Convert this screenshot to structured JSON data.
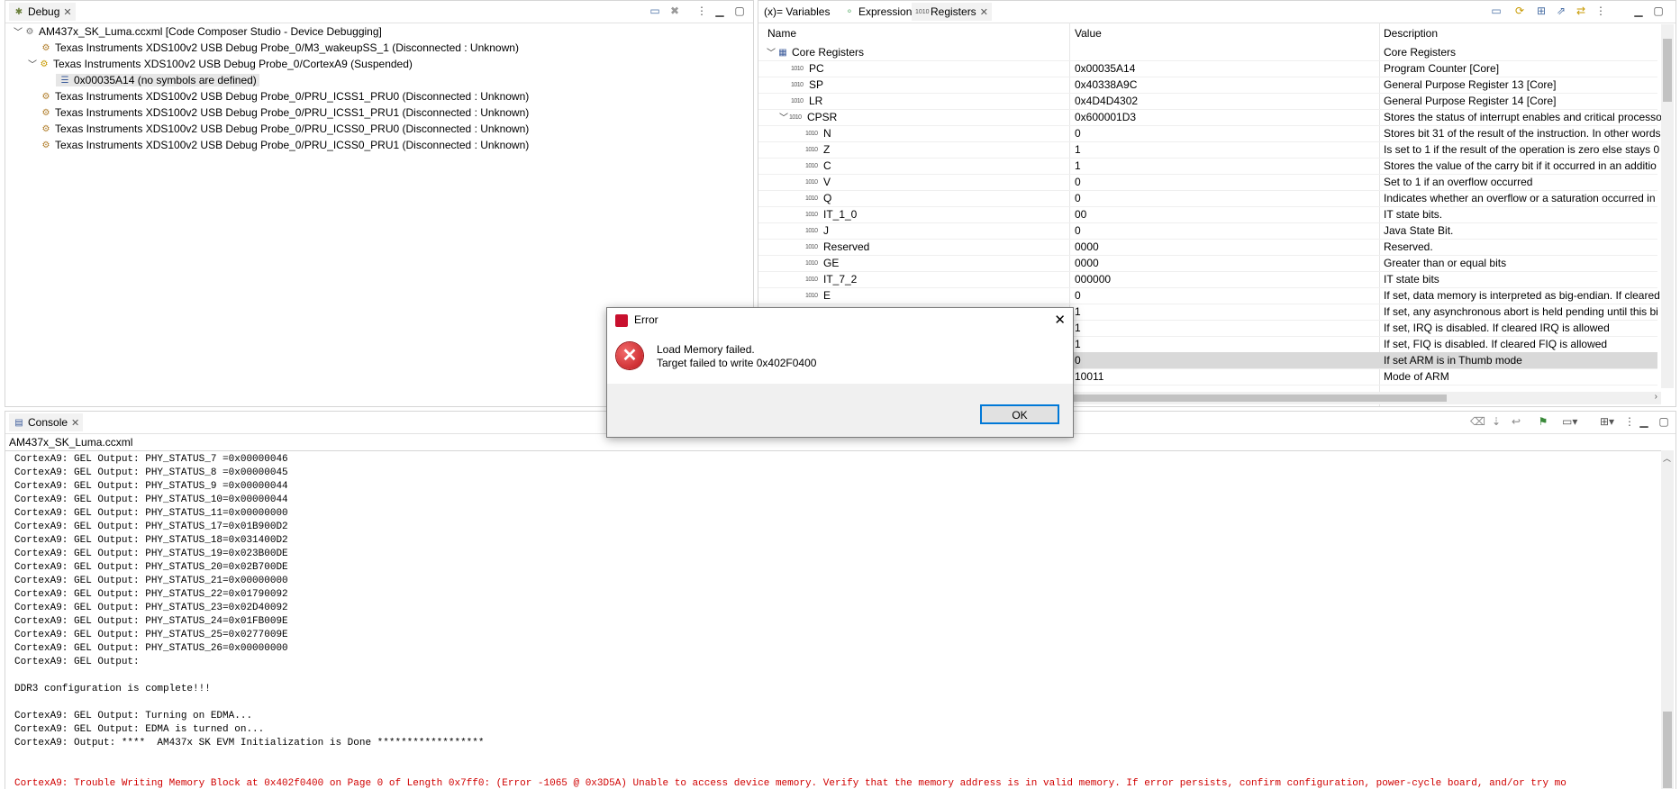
{
  "debug": {
    "tab_label": "Debug",
    "rows": [
      {
        "text": "AM437x_SK_Luma.ccxml [Code Composer Studio - Device Debugging]"
      },
      {
        "text": "Texas Instruments XDS100v2 USB Debug Probe_0/M3_wakeupSS_1 (Disconnected : Unknown)"
      },
      {
        "text": "Texas Instruments XDS100v2 USB Debug Probe_0/CortexA9 (Suspended)"
      },
      {
        "text": "0x00035A14  (no symbols are defined)"
      },
      {
        "text": "Texas Instruments XDS100v2 USB Debug Probe_0/PRU_ICSS1_PRU0 (Disconnected : Unknown)"
      },
      {
        "text": "Texas Instruments XDS100v2 USB Debug Probe_0/PRU_ICSS1_PRU1 (Disconnected : Unknown)"
      },
      {
        "text": "Texas Instruments XDS100v2 USB Debug Probe_0/PRU_ICSS0_PRU0 (Disconnected : Unknown)"
      },
      {
        "text": "Texas Instruments XDS100v2 USB Debug Probe_0/PRU_ICSS0_PRU1 (Disconnected : Unknown)"
      }
    ]
  },
  "registers": {
    "tabs": {
      "variables": "(x)= Variables",
      "expressions": "Expressions",
      "registers": "Registers"
    },
    "columns": {
      "name": "Name",
      "value": "Value",
      "description": "Description"
    },
    "rows": [
      {
        "name": "Core Registers",
        "value": "",
        "desc": "Core Registers"
      },
      {
        "name": "PC",
        "value": "0x00035A14",
        "desc": "Program Counter [Core]"
      },
      {
        "name": "SP",
        "value": "0x40338A9C",
        "desc": "General Purpose Register 13 [Core]"
      },
      {
        "name": "LR",
        "value": "0x4D4D4302",
        "desc": "General Purpose Register 14 [Core]"
      },
      {
        "name": "CPSR",
        "value": "0x600001D3",
        "desc": "Stores the status of interrupt enables and critical processo"
      },
      {
        "name": "N",
        "value": "0",
        "desc": "Stores bit 31 of the result of the instruction. In other words"
      },
      {
        "name": "Z",
        "value": "1",
        "desc": "Is set to 1 if the result of the operation is zero else stays 0"
      },
      {
        "name": "C",
        "value": "1",
        "desc": "Stores the value of the carry bit if it occurred in an additio"
      },
      {
        "name": "V",
        "value": "0",
        "desc": "Set to 1 if an overflow occurred"
      },
      {
        "name": "Q",
        "value": "0",
        "desc": "Indicates whether an overflow or a saturation occurred in"
      },
      {
        "name": "IT_1_0",
        "value": "00",
        "desc": "IT state bits."
      },
      {
        "name": "J",
        "value": "0",
        "desc": "Java State Bit."
      },
      {
        "name": "Reserved",
        "value": "0000",
        "desc": "Reserved."
      },
      {
        "name": "GE",
        "value": "0000",
        "desc": "Greater than or equal bits"
      },
      {
        "name": "IT_7_2",
        "value": "000000",
        "desc": "IT state bits"
      },
      {
        "name": "E",
        "value": "0",
        "desc": "If set, data memory is interpreted as big-endian. If cleared"
      },
      {
        "name": "",
        "value": "1",
        "desc": "If set, any asynchronous abort is held pending until this bi"
      },
      {
        "name": "",
        "value": "1",
        "desc": "If set, IRQ is disabled. If cleared IRQ is allowed"
      },
      {
        "name": "",
        "value": "1",
        "desc": "If set, FIQ is disabled. If cleared FIQ is allowed"
      },
      {
        "name": "",
        "value": "0",
        "desc": "If set ARM is in Thumb mode"
      },
      {
        "name": "",
        "value": "10011",
        "desc": "Mode of ARM"
      }
    ]
  },
  "console": {
    "tab_label": "Console",
    "subtitle": "AM437x_SK_Luma.ccxml",
    "lines": [
      "CortexA9: GEL Output: PHY_STATUS_7 =0x00000046",
      "CortexA9: GEL Output: PHY_STATUS_8 =0x00000045",
      "CortexA9: GEL Output: PHY_STATUS_9 =0x00000044",
      "CortexA9: GEL Output: PHY_STATUS_10=0x00000044",
      "CortexA9: GEL Output: PHY_STATUS_11=0x00000000",
      "CortexA9: GEL Output: PHY_STATUS_17=0x01B900D2",
      "CortexA9: GEL Output: PHY_STATUS_18=0x031400D2",
      "CortexA9: GEL Output: PHY_STATUS_19=0x023B00DE",
      "CortexA9: GEL Output: PHY_STATUS_20=0x02B700DE",
      "CortexA9: GEL Output: PHY_STATUS_21=0x00000000",
      "CortexA9: GEL Output: PHY_STATUS_22=0x01790092",
      "CortexA9: GEL Output: PHY_STATUS_23=0x02D40092",
      "CortexA9: GEL Output: PHY_STATUS_24=0x01FB009E",
      "CortexA9: GEL Output: PHY_STATUS_25=0x0277009E",
      "CortexA9: GEL Output: PHY_STATUS_26=0x00000000",
      "CortexA9: GEL Output:",
      "",
      "DDR3 configuration is complete!!!",
      "",
      "CortexA9: GEL Output: Turning on EDMA...",
      "CortexA9: GEL Output: EDMA is turned on...",
      "CortexA9: Output: ****  AM437x SK EVM Initialization is Done ******************",
      "",
      ""
    ],
    "error_line": "CortexA9: Trouble Writing Memory Block at 0x402f0400 on Page 0 of Length 0x7ff0: (Error -1065 @ 0x3D5A) Unable to access device memory. Verify that the memory address is in valid memory. If error persists, confirm configuration, power-cycle board, and/or try mo"
  },
  "dialog": {
    "title": "Error",
    "message1": "Load Memory failed.",
    "message2": "Target failed to write 0x402F0400",
    "ok_label": "OK",
    "close_glyph": "✕"
  }
}
